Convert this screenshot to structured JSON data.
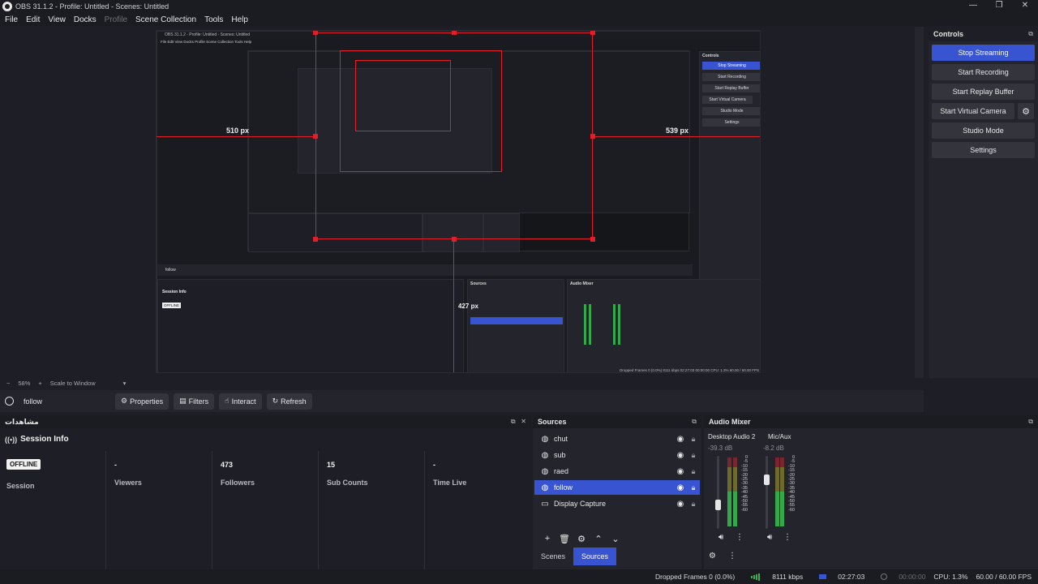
{
  "window": {
    "title": "OBS 31.1.2 - Profile: Untitled - Scenes: Untitled",
    "controls": [
      "—",
      "❐",
      "✕"
    ]
  },
  "menu": [
    "File",
    "Edit",
    "View",
    "Docks",
    "Profile",
    "Scene Collection",
    "Tools",
    "Help"
  ],
  "menu_disabled": [
    "Profile"
  ],
  "preview": {
    "nested_title": "OBS 31.1.2 - Profile: Untitled - Scenes: Untitled",
    "nested_menu": "File  Edit  View  Docks  Profile  Scene Collection  Tools  Help",
    "measure_left": "510 px",
    "measure_right": "539 px",
    "measure_bottom": "427 px",
    "nested_controls_title": "Controls",
    "nested_controls": [
      "Stop Streaming",
      "Start Recording",
      "Start Replay Buffer",
      "Start Virtual Camera",
      "Studio Mode",
      "Settings"
    ],
    "nested_source": "follow",
    "nested_session_title": "Session Info",
    "nested_offline": "OFFLINE",
    "nested_sources_title": "Sources",
    "nested_audio_title": "Audio Mixer",
    "nested_status": "Dropped Frames 0 (0.0%)   8111 kbps   02:27:03   00:00:00   CPU: 1.3%   60.00 / 60.00 FPS",
    "accent_color": "#e21e28"
  },
  "scale_bar": {
    "minus": "−",
    "zoom": "58%",
    "plus": "+",
    "mode": "Scale to Window"
  },
  "source_toolbar": {
    "current_source": "follow",
    "buttons": [
      "Properties",
      "Filters",
      "Interact",
      "Refresh"
    ]
  },
  "controls": {
    "title": "Controls",
    "buttons": [
      "Stop Streaming",
      "Start Recording",
      "Start Replay Buffer",
      "Start Virtual Camera",
      "Studio Mode",
      "Settings"
    ],
    "gear": "⚙",
    "accent": "#3954d0"
  },
  "session": {
    "dock_title": "مشاهدات",
    "title": "Session Info",
    "badge": "OFFLINE",
    "stats": [
      {
        "value": "",
        "label": "Session"
      },
      {
        "value": "-",
        "label": "Viewers"
      },
      {
        "value": "473",
        "label": "Followers"
      },
      {
        "value": "15",
        "label": "Sub Counts"
      },
      {
        "value": "-",
        "label": "Time Live"
      }
    ]
  },
  "sources": {
    "title": "Sources",
    "items": [
      {
        "name": "chut",
        "icon": "globe-icon"
      },
      {
        "name": "sub",
        "icon": "globe-icon"
      },
      {
        "name": "raed",
        "icon": "globe-icon"
      },
      {
        "name": "follow",
        "icon": "globe-icon",
        "selected": true
      },
      {
        "name": "Display Capture",
        "icon": "monitor-icon"
      }
    ],
    "tabs": [
      "Scenes",
      "Sources"
    ],
    "active_tab": "Sources"
  },
  "audio": {
    "title": "Audio Mixer",
    "channels": [
      {
        "name": "Desktop Audio 2",
        "db": "-39.3 dB",
        "volume": 0.3
      },
      {
        "name": "Mic/Aux",
        "db": "-8.2 dB",
        "volume": 0.7
      }
    ],
    "scale": [
      "0",
      "-5",
      "-10",
      "-15",
      "-20",
      "-25",
      "-30",
      "-35",
      "-40",
      "-45",
      "-50",
      "-55",
      "-60"
    ]
  },
  "status": {
    "dropped": "Dropped Frames 0 (0.0%)",
    "bitrate": "8111 kbps",
    "stream_time": "02:27:03",
    "rec_time": "00:00:00",
    "cpu": "CPU: 1.3%",
    "fps": "60.00 / 60.00 FPS"
  }
}
